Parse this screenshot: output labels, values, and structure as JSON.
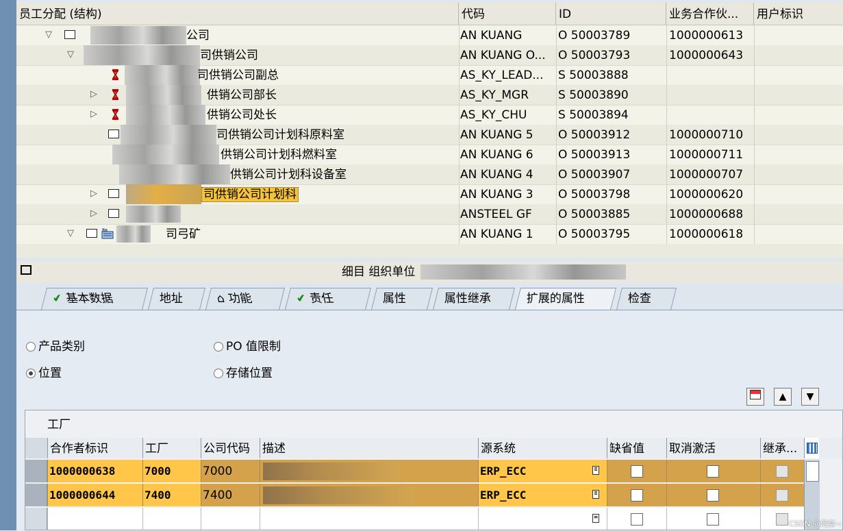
{
  "tree": {
    "columns": [
      "员工分配 (结构)",
      "代码",
      "ID",
      "业务合作伙...",
      "用户标识"
    ],
    "rows": [
      {
        "label": "公司",
        "code": "AN KUANG",
        "id": "O  50003789",
        "bp": "1000000613"
      },
      {
        "label": "司供销公司",
        "code": "AN KUANG O...",
        "id": "O  50003793",
        "bp": "1000000643"
      },
      {
        "label": "司供销公司副总",
        "code": "AS_KY_LEAD...",
        "id": "S  50003888",
        "bp": ""
      },
      {
        "label": "供销公司部长",
        "code": "AS_KY_MGR",
        "id": "S  50003890",
        "bp": ""
      },
      {
        "label": "供销公司处长",
        "code": "AS_KY_CHU",
        "id": "S  50003894",
        "bp": ""
      },
      {
        "label": "司供销公司计划科原料室",
        "code": "AN KUANG 5",
        "id": "O  50003912",
        "bp": "1000000710"
      },
      {
        "label": "供销公司计划科燃料室",
        "code": "AN KUANG 6",
        "id": "O  50003913",
        "bp": "1000000711"
      },
      {
        "label": "供销公司计划科设备室",
        "code": "AN KUANG 4",
        "id": "O  50003907",
        "bp": "1000000707"
      },
      {
        "label": "司供销公司计划科",
        "code": "AN KUANG 3",
        "id": "O  50003798",
        "bp": "1000000620"
      },
      {
        "label": "",
        "code": "ANSTEEL GF",
        "id": "O  50003885",
        "bp": "1000000688"
      },
      {
        "label": "司弓矿",
        "code": "AN KUANG 1",
        "id": "O  50003795",
        "bp": "1000000618"
      }
    ]
  },
  "detail": {
    "title": "细目 组织单位"
  },
  "tabs": [
    "基本数据",
    "地址",
    "功能",
    "责任",
    "属性",
    "属性继承",
    "扩展的属性",
    "检查"
  ],
  "radios": {
    "product_category": "产品类别",
    "po_limit": "PO 值限制",
    "location": "位置",
    "storage": "存储位置"
  },
  "grid": {
    "title": "工厂",
    "columns": [
      "合作者标识",
      "工厂",
      "公司代码",
      "描述",
      "源系统",
      "缺省值",
      "取消激活",
      "继承..."
    ],
    "rows": [
      {
        "partner": "1000000638",
        "plant": "7000",
        "company": "7000",
        "desc": "",
        "source": "ERP_ECC"
      },
      {
        "partner": "1000000644",
        "plant": "7400",
        "company": "7400",
        "desc": "",
        "source": "ERP_ECC"
      }
    ]
  },
  "watermark": "CSDN @何奈~",
  "colors": {
    "highlight": "#ffc64a",
    "row_orange": "#d3a24b",
    "selected_node": "#f6c338"
  }
}
